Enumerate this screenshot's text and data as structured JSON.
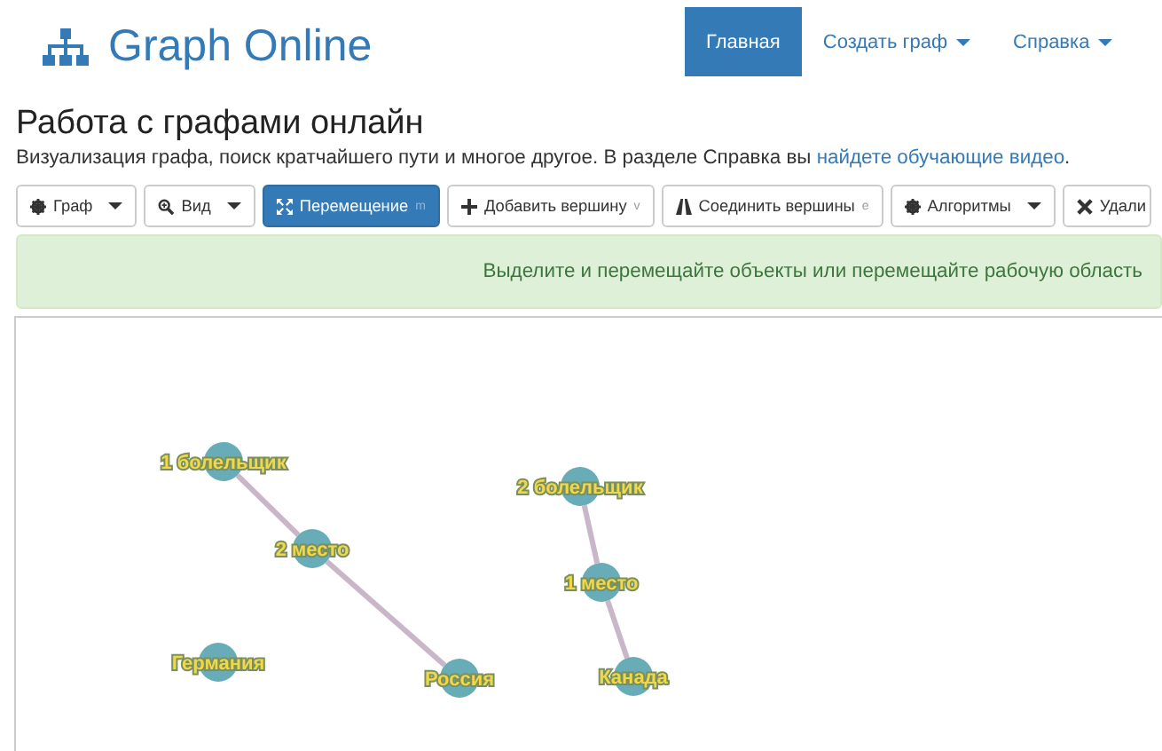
{
  "brand": "Graph Online",
  "nav": [
    {
      "label": "Главная",
      "selected": true,
      "caret": false
    },
    {
      "label": "Создать граф",
      "selected": false,
      "caret": true
    },
    {
      "label": "Справка",
      "selected": false,
      "caret": true
    }
  ],
  "heading": "Работа с графами онлайн",
  "intro": {
    "text": "Визуализация графа, поиск кратчайшего пути и многое другое. В разделе Справка вы ",
    "link": "найдете обучающие видео",
    "end": "."
  },
  "toolbar": [
    {
      "kind": "gear",
      "label": "Граф",
      "caret": true,
      "selected": false
    },
    {
      "kind": "zoom",
      "label": "Вид",
      "caret": true,
      "selected": false
    },
    {
      "kind": "move",
      "label": "Перемещение",
      "hotkey": "m",
      "caret": false,
      "selected": true
    },
    {
      "kind": "plus",
      "label": "Добавить вершину",
      "hotkey": "v",
      "caret": false,
      "selected": false
    },
    {
      "kind": "road",
      "label": "Соединить вершины",
      "hotkey": "e",
      "caret": false,
      "selected": false
    },
    {
      "kind": "gear",
      "label": "Алгоритмы",
      "caret": true,
      "selected": false
    },
    {
      "kind": "cross",
      "label": "Удали",
      "caret": false,
      "selected": false
    }
  ],
  "hint": "Выделите и перемещайте объекты или перемещайте рабочую область",
  "graph": {
    "nodes": [
      {
        "label": "1 болельщик"
      },
      {
        "label": "2 место"
      },
      {
        "label": "Германия"
      },
      {
        "label": "Россия"
      },
      {
        "label": "2 болельщик"
      },
      {
        "label": "1 место"
      },
      {
        "label": "Канада"
      }
    ]
  }
}
